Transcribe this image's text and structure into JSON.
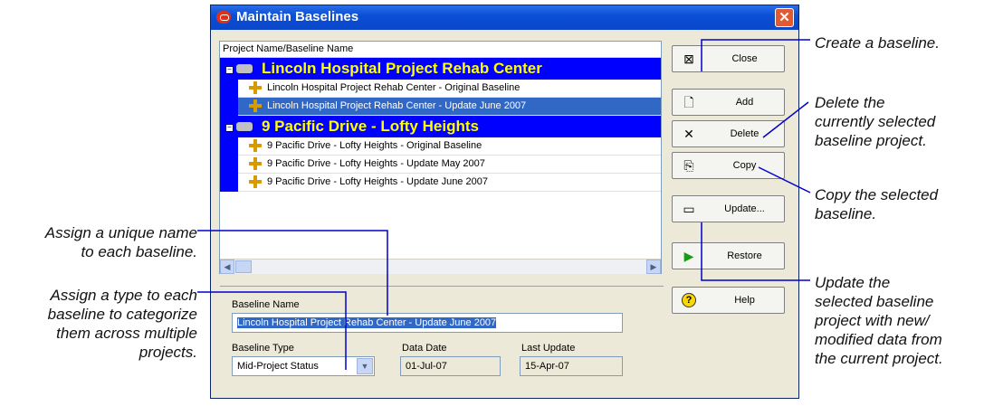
{
  "window": {
    "title": "Maintain Baselines",
    "close_glyph": "✕"
  },
  "grid": {
    "header": "Project Name/Baseline Name",
    "projects": [
      {
        "name": "Lincoln Hospital Project Rehab Center",
        "baselines": [
          {
            "name": "Lincoln Hospital Project Rehab Center - Original Baseline",
            "selected": false
          },
          {
            "name": "Lincoln Hospital Project Rehab Center - Update June 2007",
            "selected": true
          }
        ]
      },
      {
        "name": "9 Pacific Drive - Lofty Heights",
        "baselines": [
          {
            "name": "9 Pacific Drive - Lofty Heights - Original Baseline",
            "selected": false
          },
          {
            "name": "9 Pacific Drive - Lofty Heights - Update May 2007",
            "selected": false
          },
          {
            "name": "9 Pacific Drive - Lofty Heights - Update June 2007",
            "selected": false
          }
        ]
      }
    ],
    "scroll_left": "◀",
    "scroll_right": "▶"
  },
  "buttons": {
    "close": {
      "label": "Close",
      "icon": "close-window-icon"
    },
    "add": {
      "label": "Add",
      "icon": "new-document-icon"
    },
    "delete": {
      "label": "Delete",
      "icon": "x-icon"
    },
    "copy": {
      "label": "Copy",
      "icon": "copy-icon"
    },
    "update": {
      "label": "Update...",
      "icon": "update-icon"
    },
    "restore": {
      "label": "Restore",
      "icon": "play-icon"
    },
    "help": {
      "label": "Help",
      "icon": "help-icon"
    }
  },
  "form": {
    "baseline_name_label": "Baseline Name",
    "baseline_name_value": "Lincoln Hospital Project Rehab Center - Update June 2007",
    "baseline_type_label": "Baseline Type",
    "baseline_type_value": "Mid-Project Status",
    "data_date_label": "Data Date",
    "data_date_value": "01-Jul-07",
    "last_update_label": "Last Update",
    "last_update_value": "15-Apr-07"
  },
  "callouts": {
    "create": "Create a baseline.",
    "delete_lines": [
      "Delete the",
      "currently selected",
      "baseline project."
    ],
    "copy_lines": [
      "Copy the selected",
      "baseline."
    ],
    "update_lines": [
      "Update the",
      "selected baseline",
      "project with new/",
      "modified data from",
      "the current project."
    ],
    "name_lines": [
      "Assign a unique name",
      "to each baseline."
    ],
    "type_lines": [
      "Assign a type to each",
      "baseline to categorize",
      "them across multiple",
      "projects."
    ]
  },
  "colors": {
    "project_row_bg": "#0000ff",
    "project_text": "#ffff00",
    "selection": "#3168c6",
    "callout_line": "#0000cc"
  }
}
